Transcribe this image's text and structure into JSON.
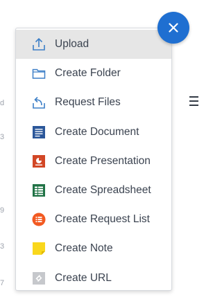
{
  "background": {
    "left_fragments": [
      "d",
      "3",
      "9",
      "3",
      "7"
    ]
  },
  "close_button": {
    "icon": "close-icon",
    "color": "#1f6fd1"
  },
  "menu": {
    "items": [
      {
        "label": "Upload",
        "icon": "upload-icon",
        "active": true
      },
      {
        "label": "Create Folder",
        "icon": "folder-icon"
      },
      {
        "label": "Request Files",
        "icon": "request-files-icon"
      },
      {
        "label": "Create Document",
        "icon": "document-icon",
        "color": "#2b579a"
      },
      {
        "label": "Create Presentation",
        "icon": "presentation-icon",
        "color": "#d24726"
      },
      {
        "label": "Create Spreadsheet",
        "icon": "spreadsheet-icon",
        "color": "#217346"
      },
      {
        "label": "Create Request List",
        "icon": "request-list-icon",
        "color": "#f25a22"
      },
      {
        "label": "Create Note",
        "icon": "note-icon",
        "color": "#f9d71c"
      },
      {
        "label": "Create URL",
        "icon": "link-icon",
        "color": "#c6c8cc"
      }
    ]
  }
}
